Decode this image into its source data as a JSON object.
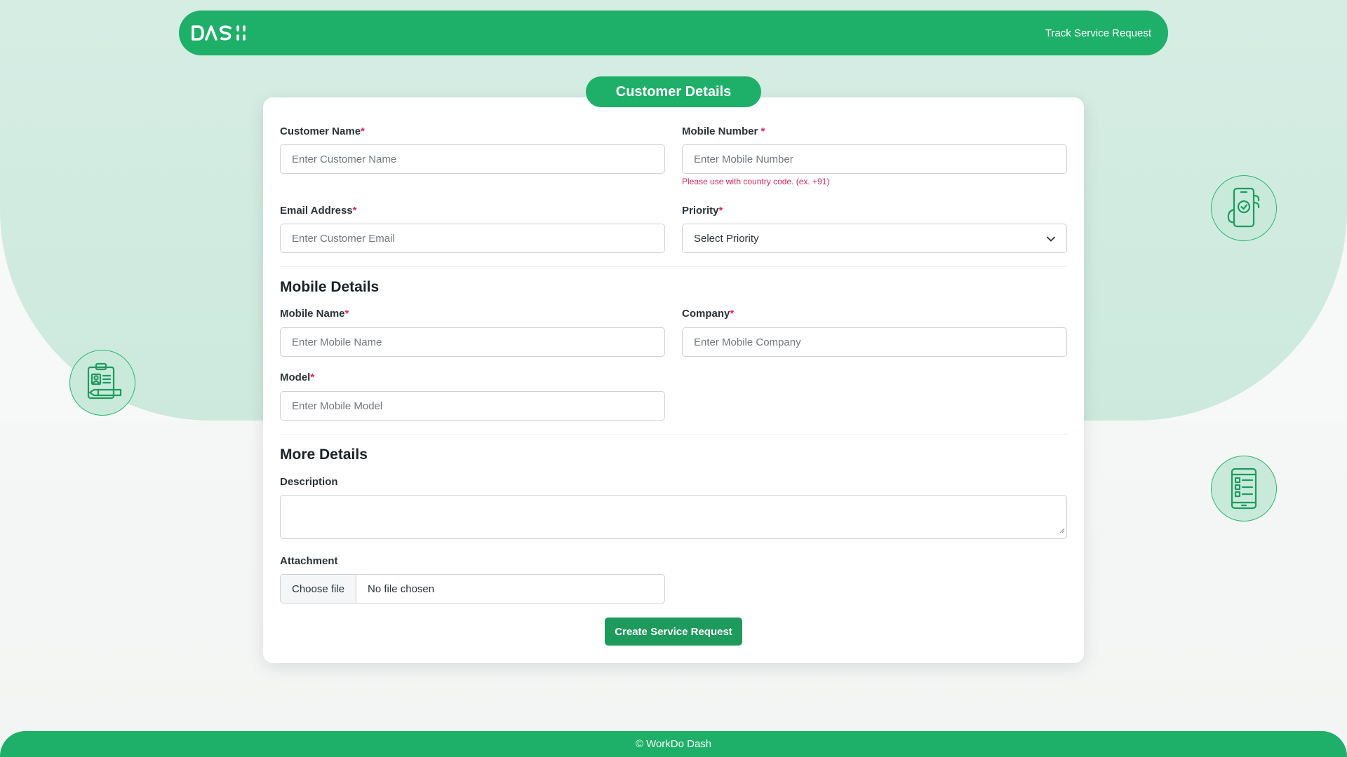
{
  "header": {
    "logo_text": "DASH",
    "track_link": "Track Service Request"
  },
  "form": {
    "title": "Customer Details",
    "customer_name": {
      "label": "Customer Name",
      "required": "*",
      "placeholder": "Enter Customer Name"
    },
    "mobile_number": {
      "label": "Mobile Number",
      "required": "*",
      "placeholder": "Enter Mobile Number",
      "help": "Please use with country code. (ex. +91)"
    },
    "email": {
      "label": "Email Address",
      "required": "*",
      "placeholder": "Enter Customer Email"
    },
    "priority": {
      "label": "Priority",
      "required": "*",
      "value": "Select Priority"
    },
    "mobile_section": "Mobile Details",
    "mobile_name": {
      "label": "Mobile Name",
      "required": "*",
      "placeholder": "Enter Mobile Name"
    },
    "company": {
      "label": "Company",
      "required": "*",
      "placeholder": "Enter Mobile Company"
    },
    "model": {
      "label": "Model",
      "required": "*",
      "placeholder": "Enter Mobile Model"
    },
    "more_section": "More Details",
    "description": {
      "label": "Description"
    },
    "attachment": {
      "label": "Attachment",
      "button": "Choose file",
      "status": "No file chosen"
    },
    "submit": "Create Service Request"
  },
  "decor_icons": [
    "phone-check-icon",
    "clipboard-id-icon",
    "phone-checklist-icon"
  ],
  "footer": {
    "text": "© WorkDo Dash"
  },
  "colors": {
    "brand": "#1eaf68",
    "button": "#1d9a5c",
    "required": "#e0245e",
    "bg_soft": "#d6ede4"
  }
}
